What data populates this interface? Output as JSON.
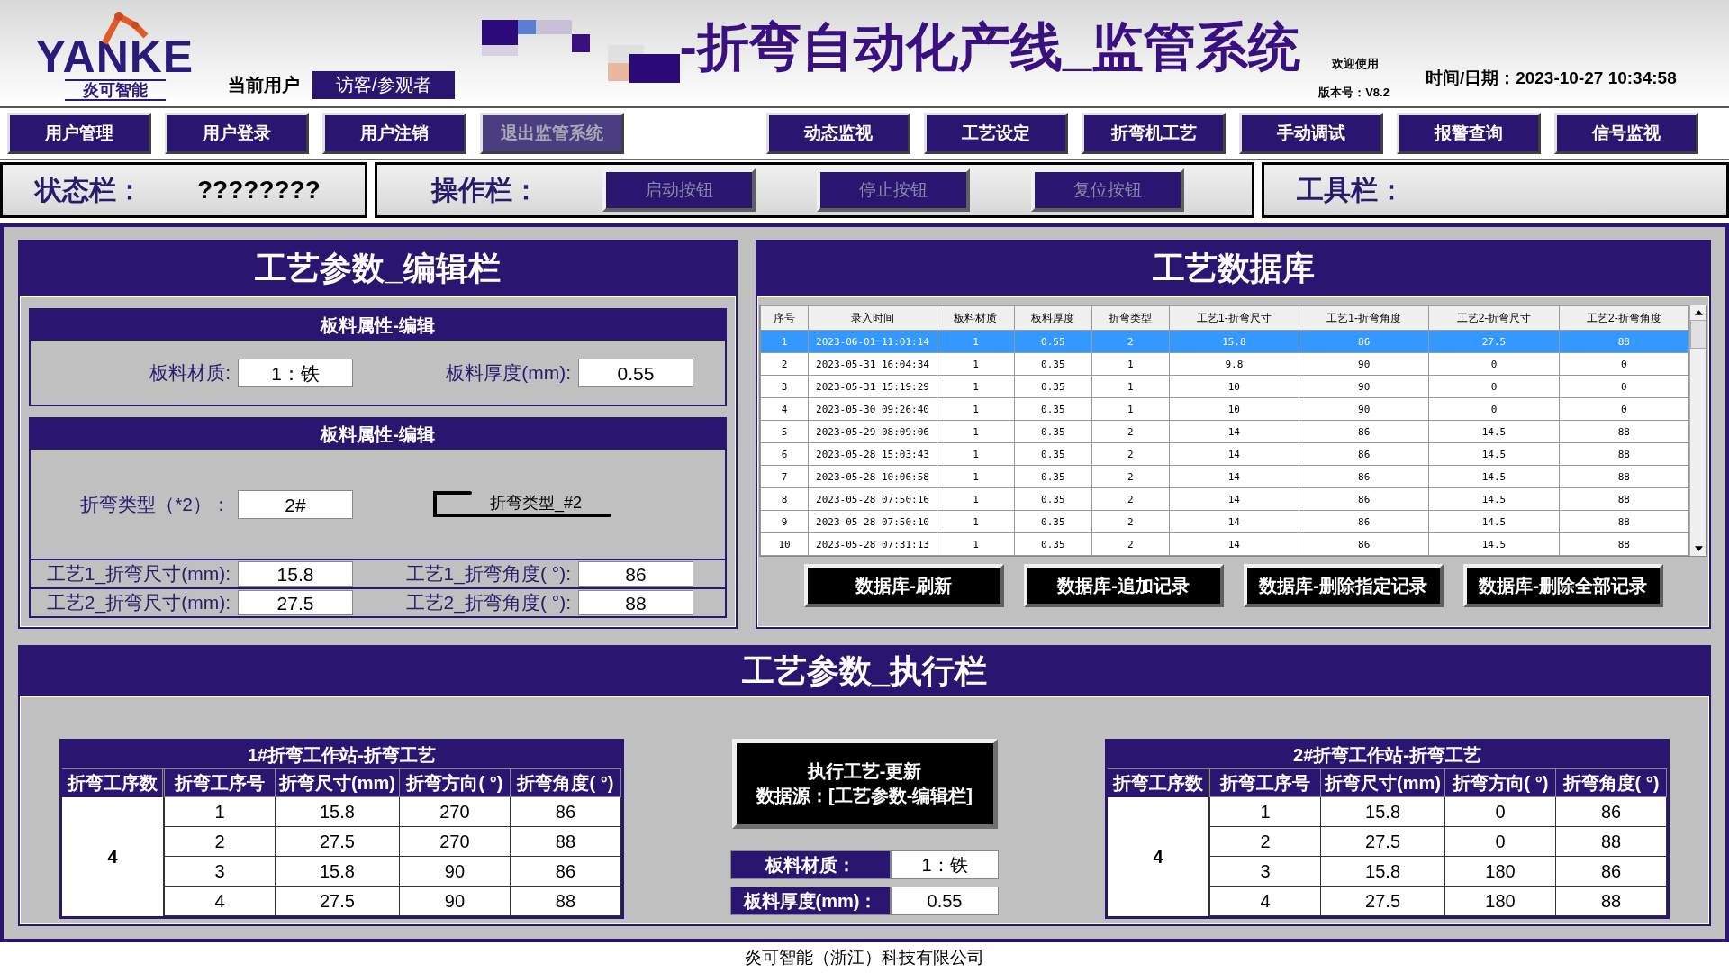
{
  "header": {
    "logo_text": "YANKE",
    "logo_subtitle": "炎可智能",
    "user_label": "当前用户",
    "user_value": "访客/参观者",
    "title": "-折弯自动化产线_监管系统",
    "welcome": "欢迎使用",
    "version": "版本号：V8.2",
    "datetime": "时间/日期：2023-10-27 10:34:58"
  },
  "nav_left": [
    {
      "label": "用户管理",
      "disabled": false
    },
    {
      "label": "用户登录",
      "disabled": false
    },
    {
      "label": "用户注销",
      "disabled": false
    },
    {
      "label": "退出监管系统",
      "disabled": true
    }
  ],
  "nav_right": [
    {
      "label": "动态监视",
      "disabled": false
    },
    {
      "label": "工艺设定",
      "disabled": false
    },
    {
      "label": "折弯机工艺",
      "disabled": false
    },
    {
      "label": "手动调试",
      "disabled": false
    },
    {
      "label": "报警查询",
      "disabled": false
    },
    {
      "label": "信号监视",
      "disabled": false
    }
  ],
  "status_bar": {
    "label": "状态栏：",
    "value": "????????"
  },
  "operation_bar": {
    "label": "操作栏：",
    "buttons": [
      {
        "label": "启动按钮",
        "disabled": true
      },
      {
        "label": "停止按钮",
        "disabled": true
      },
      {
        "label": "复位按钮",
        "disabled": true
      }
    ]
  },
  "toolbar": {
    "label": "工具栏："
  },
  "edit_panel": {
    "title": "工艺参数_编辑栏",
    "material_section": {
      "title": "板料属性-编辑",
      "material_label": "板料材质:",
      "material_value": "1：铁",
      "thickness_label": "板料厚度(mm):",
      "thickness_value": "0.55"
    },
    "bend_section": {
      "title": "板料属性-编辑",
      "type_label": "折弯类型（*2）：",
      "type_value": "2#",
      "diagram_label": "折弯类型_#2"
    },
    "process_rows": [
      {
        "size_label": "工艺1_折弯尺寸(mm):",
        "size_value": "15.8",
        "angle_label": "工艺1_折弯角度( °):",
        "angle_value": "86"
      },
      {
        "size_label": "工艺2_折弯尺寸(mm):",
        "size_value": "27.5",
        "angle_label": "工艺2_折弯角度( °):",
        "angle_value": "88"
      }
    ]
  },
  "database": {
    "title": "工艺数据库",
    "columns": [
      "序号",
      "录入时间",
      "板料材质",
      "板料厚度",
      "折弯类型",
      "工艺1-折弯尺寸",
      "工艺1-折弯角度",
      "工艺2-折弯尺寸",
      "工艺2-折弯角度"
    ],
    "rows": [
      {
        "selected": true,
        "cells": [
          "1",
          "2023-06-01 11:01:14",
          "1",
          "0.55",
          "2",
          "15.8",
          "86",
          "27.5",
          "88"
        ]
      },
      {
        "selected": false,
        "cells": [
          "2",
          "2023-05-31 16:04:34",
          "1",
          "0.35",
          "1",
          "9.8",
          "90",
          "0",
          "0"
        ]
      },
      {
        "selected": false,
        "cells": [
          "3",
          "2023-05-31 15:19:29",
          "1",
          "0.35",
          "1",
          "10",
          "90",
          "0",
          "0"
        ]
      },
      {
        "selected": false,
        "cells": [
          "4",
          "2023-05-30 09:26:40",
          "1",
          "0.35",
          "1",
          "10",
          "90",
          "0",
          "0"
        ]
      },
      {
        "selected": false,
        "cells": [
          "5",
          "2023-05-29 08:09:06",
          "1",
          "0.35",
          "2",
          "14",
          "86",
          "14.5",
          "88"
        ]
      },
      {
        "selected": false,
        "cells": [
          "6",
          "2023-05-28 15:03:43",
          "1",
          "0.35",
          "2",
          "14",
          "86",
          "14.5",
          "88"
        ]
      },
      {
        "selected": false,
        "cells": [
          "7",
          "2023-05-28 10:06:58",
          "1",
          "0.35",
          "2",
          "14",
          "86",
          "14.5",
          "88"
        ]
      },
      {
        "selected": false,
        "cells": [
          "8",
          "2023-05-28 07:50:16",
          "1",
          "0.35",
          "2",
          "14",
          "86",
          "14.5",
          "88"
        ]
      },
      {
        "selected": false,
        "cells": [
          "9",
          "2023-05-28 07:50:10",
          "1",
          "0.35",
          "2",
          "14",
          "86",
          "14.5",
          "88"
        ]
      },
      {
        "selected": false,
        "cells": [
          "10",
          "2023-05-28 07:31:13",
          "1",
          "0.35",
          "2",
          "14",
          "86",
          "14.5",
          "88"
        ]
      }
    ],
    "buttons": [
      "数据库-刷新",
      "数据库-追加记录",
      "数据库-删除指定记录",
      "数据库-删除全部记录"
    ]
  },
  "execute_panel": {
    "title": "工艺参数_执行栏",
    "stations": [
      {
        "title": "1#折弯工作站-折弯工艺",
        "count_header": "折弯工序数",
        "count": "4",
        "columns": [
          "折弯工序号",
          "折弯尺寸(mm)",
          "折弯方向( °)",
          "折弯角度( °)"
        ],
        "rows": [
          [
            "1",
            "15.8",
            "270",
            "86"
          ],
          [
            "2",
            "27.5",
            "270",
            "88"
          ],
          [
            "3",
            "15.8",
            "90",
            "86"
          ],
          [
            "4",
            "27.5",
            "90",
            "88"
          ]
        ]
      },
      {
        "title": "2#折弯工作站-折弯工艺",
        "count_header": "折弯工序数",
        "count": "4",
        "columns": [
          "折弯工序号",
          "折弯尺寸(mm)",
          "折弯方向( °)",
          "折弯角度( °)"
        ],
        "rows": [
          [
            "1",
            "15.8",
            "0",
            "86"
          ],
          [
            "2",
            "27.5",
            "0",
            "88"
          ],
          [
            "3",
            "15.8",
            "180",
            "86"
          ],
          [
            "4",
            "27.5",
            "180",
            "88"
          ]
        ]
      }
    ],
    "execute_button": [
      "执行工艺-更新",
      "数据源：[工艺参数-编辑栏]"
    ],
    "material_label": "板料材质：",
    "material_value": "1：铁",
    "thickness_label": "板料厚度(mm)：",
    "thickness_value": "0.55"
  },
  "footer": "炎可智能（浙江）科技有限公司"
}
